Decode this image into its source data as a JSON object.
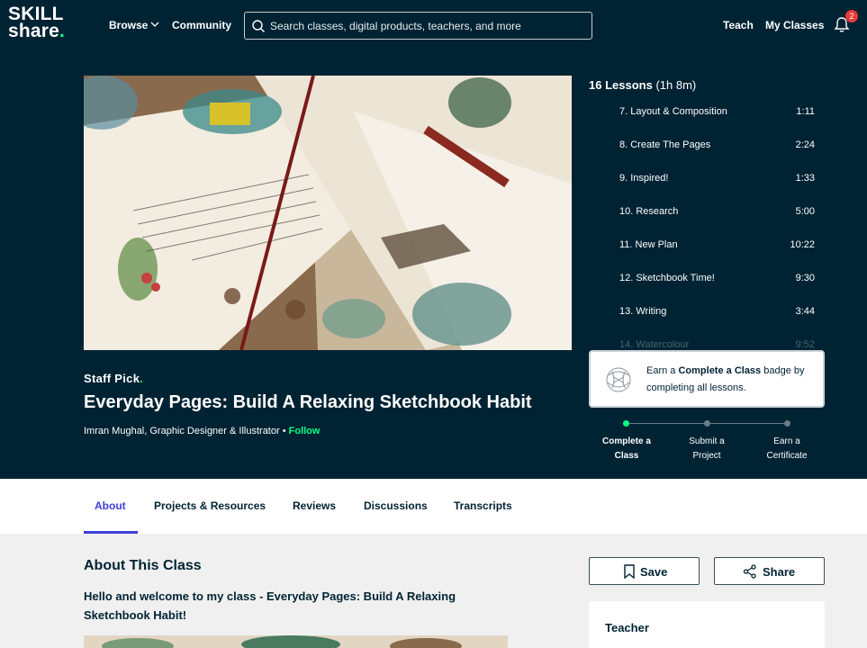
{
  "nav": {
    "logo_top": "SKILL",
    "logo_bottom": "share",
    "browse": "Browse",
    "community": "Community",
    "search_placeholder": "Search classes, digital products, teachers, and more",
    "teach": "Teach",
    "my_classes": "My Classes",
    "notification_count": "2"
  },
  "hero": {
    "staff_pick": "Staff Pick",
    "title": "Everyday Pages: Build A Relaxing Sketchbook Habit",
    "byline": "Imran Mughal, Graphic Designer & Illustrator •",
    "follow": "Follow"
  },
  "lessons": {
    "count_label": "16 Lessons",
    "duration": "(1h 8m)",
    "items": [
      {
        "name": "7.  Layout & Composition",
        "time": "1:11"
      },
      {
        "name": "8.  Create The Pages",
        "time": "2:24"
      },
      {
        "name": "9.  Inspired!",
        "time": "1:33"
      },
      {
        "name": "10.  Research",
        "time": "5:00"
      },
      {
        "name": "11.  New Plan",
        "time": "10:22"
      },
      {
        "name": "12.  Sketchbook Time!",
        "time": "9:30"
      },
      {
        "name": "13.  Writing",
        "time": "3:44"
      },
      {
        "name": "14.  Watercolour",
        "time": "9:52"
      }
    ]
  },
  "earn_badge": {
    "prefix": "Earn a ",
    "bold": "Complete a Class",
    "suffix": " badge by completing all lessons."
  },
  "progress_steps": [
    {
      "line1": "Complete a",
      "line2": "Class"
    },
    {
      "line1": "Submit a",
      "line2": "Project"
    },
    {
      "line1": "Earn a",
      "line2": "Certificate"
    }
  ],
  "tabs": [
    "About",
    "Projects & Resources",
    "Reviews",
    "Discussions",
    "Transcripts"
  ],
  "about": {
    "title": "About This Class",
    "intro": "Hello and welcome to my class - Everyday Pages: Build A Relaxing Sketchbook Habit!"
  },
  "actions": {
    "save": "Save",
    "share": "Share"
  },
  "teacher_card": {
    "title": "Teacher"
  },
  "colors": {
    "navy": "#002333",
    "green": "#00ff84",
    "tab_active": "#3d3fd8",
    "badge": "#e83a3a"
  }
}
